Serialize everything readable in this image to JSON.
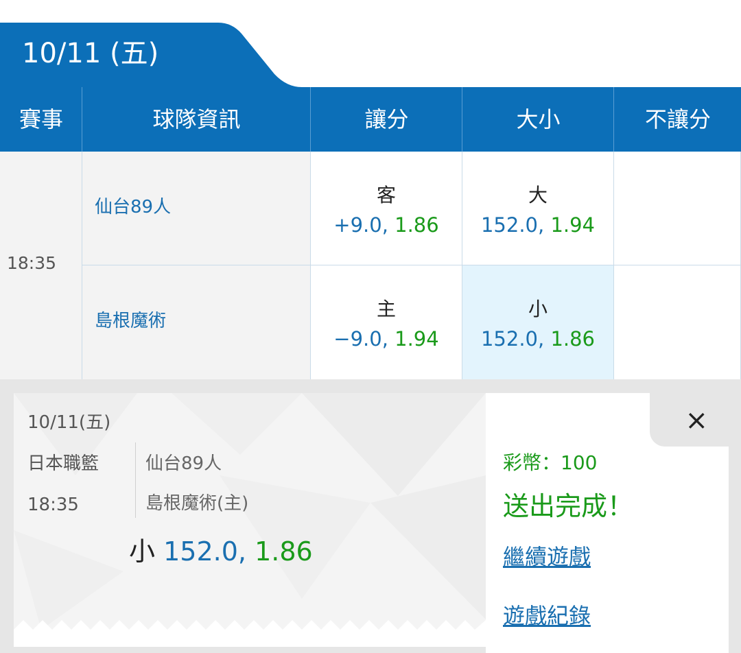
{
  "date_tab": {
    "text": "10/11 (五)"
  },
  "table": {
    "headers": [
      "賽事",
      "球隊資訊",
      "讓分",
      "大小",
      "不讓分"
    ],
    "time": "18:35",
    "rows": [
      {
        "team": "仙台89人",
        "spread": {
          "label": "客",
          "line": "+9.0",
          "odds": "1.86"
        },
        "total": {
          "label": "大",
          "line": "152.0",
          "odds": "1.94"
        }
      },
      {
        "team": "島根魔術",
        "spread": {
          "label": "主",
          "line": "−9.0",
          "odds": "1.94"
        },
        "total": {
          "label": "小",
          "line": "152.0",
          "odds": "1.86",
          "selected": true
        }
      }
    ]
  },
  "ticket": {
    "date": "10/11(五)",
    "league": "日本職籃",
    "time": "18:35",
    "team1": "仙台89人",
    "team2": "島根魔術(主)",
    "pick_label": "小",
    "pick_line": "152.0,",
    "pick_odds": "1.86"
  },
  "result": {
    "coins": "彩幣：100",
    "status": "送出完成！",
    "continue_link": "繼續遊戲",
    "history_link": "遊戲紀錄",
    "close_symbol": "×"
  },
  "colors": {
    "header_blue": "#0c6fb8",
    "odds_blue": "#1a6fb0",
    "odds_green": "#1a9a1a",
    "selected_bg": "#e3f4fd"
  }
}
